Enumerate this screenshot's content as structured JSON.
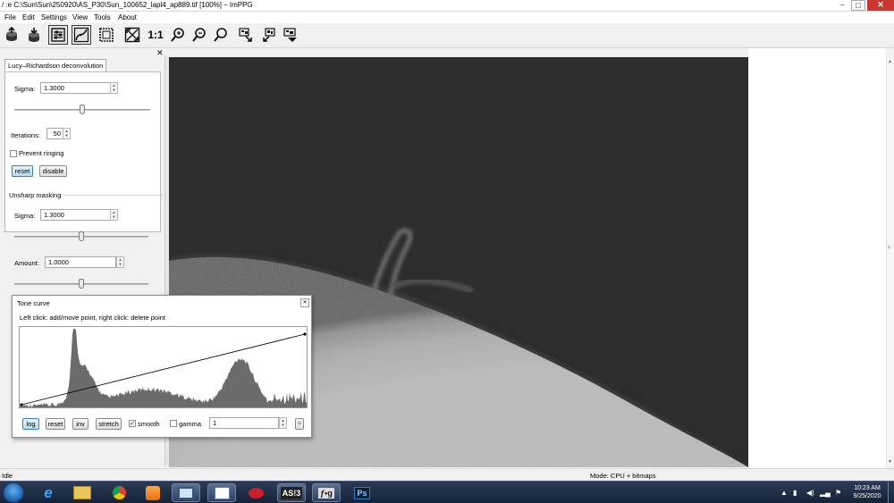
{
  "window": {
    "title": "/ :e C:\\Sun\\Sun\\250920\\AS_P30\\Sun_100652_lapl4_ap889.tif [100%] – ImPPG",
    "min": "–",
    "max": "□",
    "close": "✕"
  },
  "menu": [
    "File",
    "Edit",
    "Settings",
    "View",
    "Tools",
    "About"
  ],
  "toolbar": {
    "zoom_1to1": "1:1",
    "icons": [
      "open-file-icon",
      "save-file-icon",
      "processing-panel-icon",
      "tone-curve-icon",
      "fit-window-icon",
      "fit-image-icon",
      "actual-size-icon",
      "zoom-in-icon",
      "zoom-out-icon",
      "zoom-custom-icon",
      "align-icon",
      "batch-icon",
      "export-icon"
    ]
  },
  "panel": {
    "close": "✕",
    "lr": {
      "tab": "Lucy–Richardson deconvolution",
      "sigma_label": "Sigma:",
      "sigma_value": "1.3000",
      "sigma_slider": 0.5,
      "iterations_label": "Iterations:",
      "iterations_value": "50",
      "prevent_ringing_label": "Prevent ringing",
      "prevent_ringing_checked": false,
      "reset": "reset",
      "disable": "disable"
    },
    "unsharp": {
      "header": "Unsharp masking",
      "sigma_label": "Sigma:",
      "sigma_value": "1.3000",
      "sigma_slider": 0.5,
      "amount_label": "Amount:",
      "amount_value": "1.0000",
      "amount_slider": 0.5
    }
  },
  "status": {
    "left": "Idle",
    "mode": "Mode: CPU + bitmaps"
  },
  "tone_curve": {
    "title": "Tone curve",
    "close": "✕",
    "hint": "Left click: add/move point, right click: delete point",
    "log": "log",
    "reset": "reset",
    "inv": "inv",
    "stretch": "stretch",
    "smooth_label": "smooth",
    "smooth_checked": true,
    "gamma_label": "gamma",
    "gamma_checked": false,
    "gamma_value": "1",
    "ok": "☺"
  },
  "taskbar": {
    "apps": [
      "windows-explorer-icon",
      "internet-explorer-icon",
      "folder-icon",
      "chrome-icon",
      "media-player-icon",
      "monitor-app-icon",
      "window-app-icon",
      "red-app-icon",
      "asi-app-icon",
      "fg-app-icon",
      "photoshop-icon"
    ],
    "asi_label": "AS!3",
    "fg_label": "ƒ•g",
    "ps_label": "Ps",
    "clock_time": "10:23 AM",
    "clock_date": "9/25/2020"
  },
  "colors": {
    "sky": "#2d2d2e",
    "histogram": "#6b6b6b",
    "button_active": "#b3dcf4",
    "taskbar": "#1b2a44"
  }
}
